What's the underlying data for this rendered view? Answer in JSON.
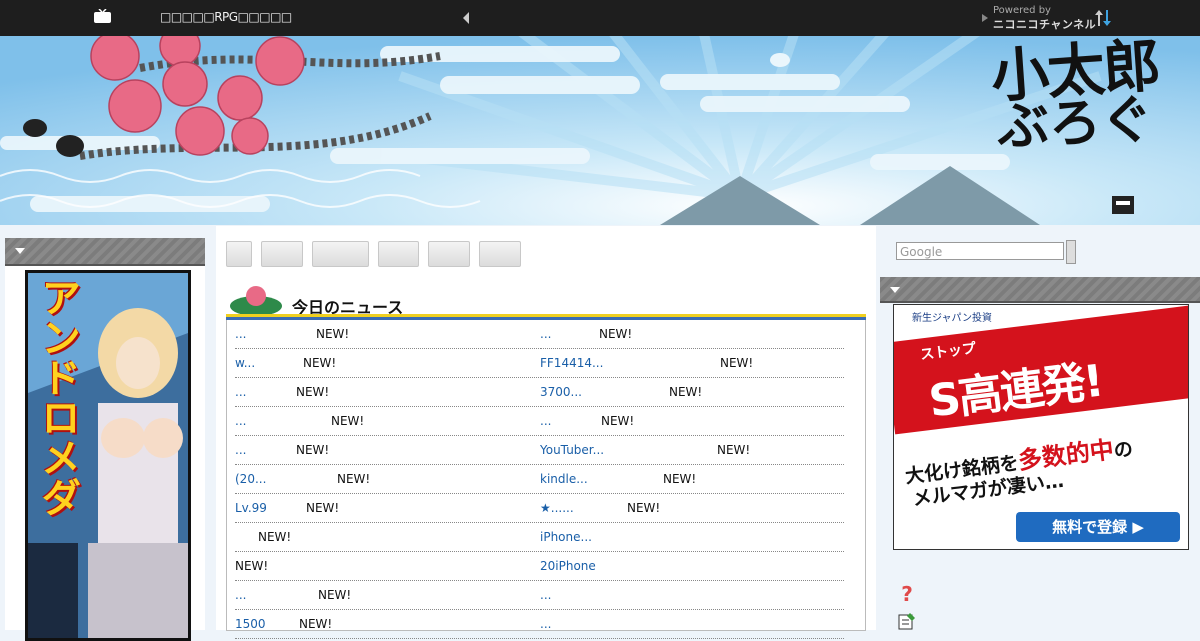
{
  "topbar": {
    "title": "□□□□□RPG□□□□□",
    "powered_by": "Powered by",
    "channel": "ニコニコチャンネル",
    "icons": [
      "tv-icon",
      "prev-arrow-icon",
      "next-arrow-icon",
      "sort-arrows-icon"
    ]
  },
  "banner": {
    "logo_line1": "小太郎",
    "logo_line2": "ぶろぐ"
  },
  "left_ad": {
    "text": "アンドロメダ"
  },
  "news": {
    "heading": "今日のニュース",
    "left": [
      {
        "link": "...",
        "new": "NEW!"
      },
      {
        "link": "w...",
        "new": "NEW!"
      },
      {
        "link": "...",
        "new": "NEW!"
      },
      {
        "link": " ...",
        "new": "NEW!"
      },
      {
        "link": "...",
        "new": "NEW!"
      },
      {
        "link": "(20...",
        "new": "NEW!"
      },
      {
        "link": "Lv.99",
        "new": "NEW!"
      },
      {
        "link": "",
        "new": "NEW!"
      },
      {
        "link": "",
        "new": "NEW!"
      },
      {
        "link": "...",
        "new": "NEW!"
      },
      {
        "link": "1500",
        "new": "NEW!"
      }
    ],
    "right": [
      {
        "link": "...",
        "new": "NEW!"
      },
      {
        "link": "FF14414...",
        "new": "NEW!"
      },
      {
        "link": "3700...",
        "new": "NEW!"
      },
      {
        "link": "...",
        "new": "NEW!"
      },
      {
        "link": "YouTuber...",
        "new": "NEW!"
      },
      {
        "link": "kindle...",
        "new": "NEW!"
      },
      {
        "link": "★......",
        "new": "NEW!"
      },
      {
        "link": "iPhone...",
        "new": ""
      },
      {
        "link": "20iPhone",
        "new": ""
      },
      {
        "link": " ...",
        "new": ""
      },
      {
        "link": "...",
        "new": ""
      }
    ]
  },
  "search": {
    "placeholder": "Google"
  },
  "right_ad": {
    "brand": "新生ジャパン投資",
    "stop": "ストップ",
    "headline": "S高連発!",
    "line1_a": "大化け銘柄を",
    "line1_b": "多数的中",
    "line1_c": "の",
    "line2": "メルマガが凄い…",
    "cta": "無料で登録 ▶"
  },
  "colors": {
    "link": "#1a5fa8",
    "topbar": "#1e1e1e",
    "accent_red": "#d4121c",
    "accent_blue": "#1f6bc0"
  }
}
